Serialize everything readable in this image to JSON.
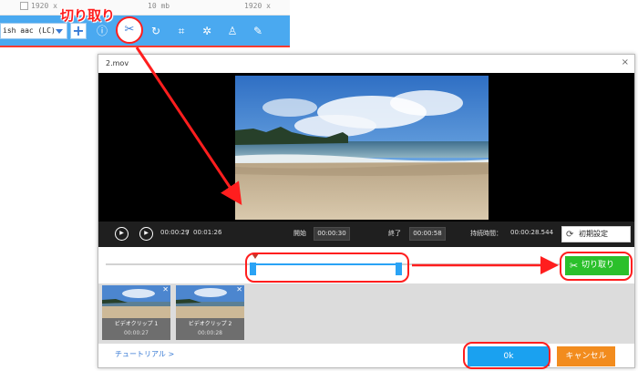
{
  "top_toolbar": {
    "info_left": "1920 x",
    "info_right": "1920 x",
    "info_mid": "10 mb",
    "codec_value": "ish aac (LC)",
    "plus_label": "+",
    "callout_label": "切り取り",
    "icons": [
      "info-icon",
      "scissors-icon",
      "rotate-icon",
      "crop-icon",
      "effects-icon",
      "watermark-icon",
      "subtitle-edit-icon"
    ]
  },
  "dialog": {
    "title": "2.mov",
    "close_label": "×",
    "controls": {
      "current_time": "00:00:29",
      "separator": "/",
      "total_time": "00:01:26",
      "start_label": "開始",
      "start_value": "00:00:30",
      "end_label": "終了",
      "end_value": "00:00:58",
      "duration_label": "持続時間：",
      "duration_value": "00:00:28.544",
      "reset_label": "初期設定"
    },
    "timeline": {
      "cut_label": "切り取り",
      "selection_start": 0.335,
      "selection_end": 0.665
    },
    "clips": [
      {
        "name": "ビデオクリップ 1",
        "duration": "00:00:27"
      },
      {
        "name": "ビデオクリップ 2",
        "duration": "00:00:28"
      }
    ],
    "tutorial_label": "チュートリアル >",
    "ok_label": "0k",
    "cancel_label": "キャンセル"
  },
  "colors": {
    "toolbar_blue": "#4aa9f0",
    "highlight_red": "#ff1e1e",
    "cut_green": "#2bc02b",
    "ok_blue": "#1aa1f0",
    "cancel_orange": "#f28c1e",
    "selection_blue": "#2aa3f5"
  }
}
